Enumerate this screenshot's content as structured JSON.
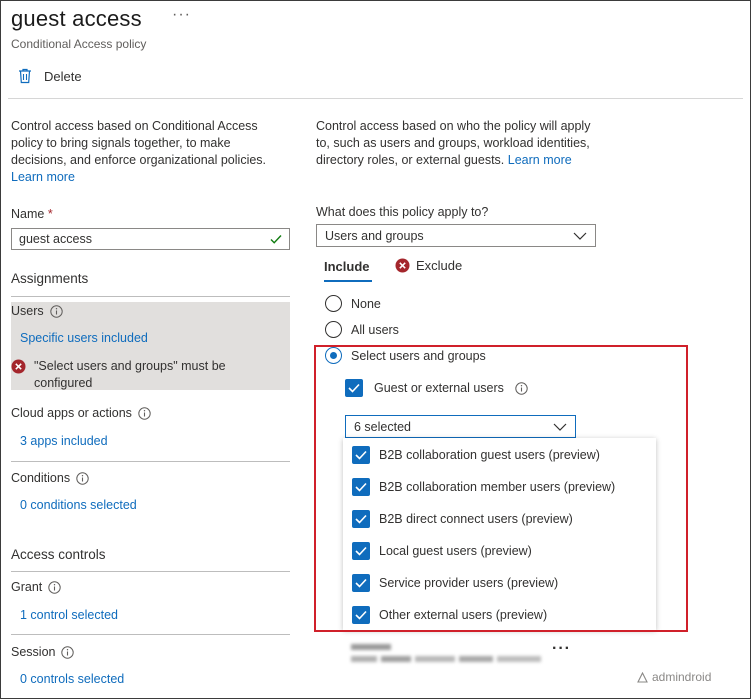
{
  "header": {
    "title": "guest access",
    "more_icon": "ellipsis-icon",
    "subtitle": "Conditional Access policy"
  },
  "toolbar": {
    "delete_label": "Delete",
    "delete_icon": "trash-icon"
  },
  "left": {
    "intro_text": "Control access based on Conditional Access policy to bring signals together, to make decisions, and enforce organizational policies.",
    "learn_more": "Learn more",
    "name_label": "Name",
    "required_mark": "*",
    "name_value": "guest access",
    "assignments_heading": "Assignments",
    "users_label": "Users",
    "users_link": "Specific users included",
    "users_error": "\"Select users and groups\" must be configured",
    "cloud_apps_label": "Cloud apps or actions",
    "cloud_apps_link": "3 apps included",
    "conditions_label": "Conditions",
    "conditions_link": "0 conditions selected",
    "access_controls_heading": "Access controls",
    "grant_label": "Grant",
    "grant_link": "1 control selected",
    "session_label": "Session",
    "session_link": "0 controls selected"
  },
  "right": {
    "intro_text": "Control access based on who the policy will apply to, such as users and groups, workload identities, directory roles, or external guests.",
    "learn_more": "Learn more",
    "apply_to_label": "What does this policy apply to?",
    "apply_to_value": "Users and groups",
    "tabs": {
      "include": "Include",
      "exclude": "Exclude"
    },
    "radios": {
      "none": "None",
      "all_users": "All users",
      "select": "Select users and groups"
    },
    "guest_checkbox": "Guest or external users",
    "selected_dropdown": "6 selected",
    "options": [
      "B2B collaboration guest users (preview)",
      "B2B collaboration member users (preview)",
      "B2B direct connect users (preview)",
      "Local guest users (preview)",
      "Service provider users (preview)",
      "Other external users (preview)"
    ]
  },
  "watermark": "admindroid",
  "colors": {
    "accent": "#0f6cbd",
    "error": "#a4262c",
    "highlight": "#d0202a"
  }
}
